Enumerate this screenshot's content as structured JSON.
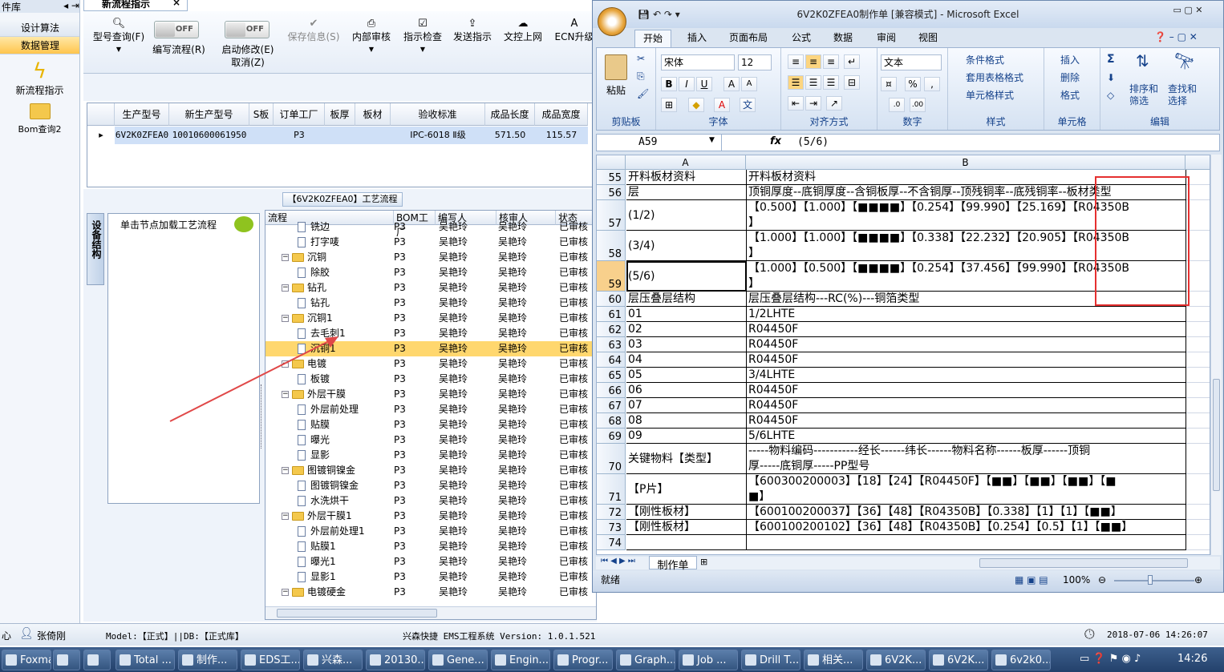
{
  "left_nav": {
    "header": "件库",
    "items": [
      {
        "label": "设计算法",
        "active": false
      },
      {
        "label": "数据管理",
        "active": true
      }
    ],
    "tools": [
      {
        "label": "新流程指示",
        "icon": "lightning-icon"
      },
      {
        "label": "Bom查询2",
        "icon": "folder-icon"
      }
    ]
  },
  "app": {
    "tab_title": "新流程指示",
    "toolbar": [
      {
        "label": "型号查询(F)",
        "icon": "search-icon"
      },
      {
        "label": "编写流程(R)",
        "toggle": "OFF"
      },
      {
        "label": "启动修改(E)",
        "sub": "取消(Z)",
        "toggle": "OFF"
      },
      {
        "label": "保存信息(S)",
        "icon": "check-icon"
      },
      {
        "label": "内部审核",
        "icon": "printer-icon"
      },
      {
        "label": "指示检查",
        "icon": "checkbox-icon"
      },
      {
        "label": "发送指示",
        "icon": "upload-icon"
      },
      {
        "label": "文控上网",
        "icon": "cloud-icon"
      },
      {
        "label": "ECN升级",
        "icon": "text-icon"
      }
    ],
    "grid": {
      "headers": [
        "生产型号",
        "新生产型号",
        "S板",
        "订单工厂",
        "板厚",
        "板材",
        "验收标准",
        "成品长度",
        "成品宽度"
      ],
      "row": [
        "6V2K0ZFEA0",
        "10010600061950",
        "",
        "P3",
        "",
        "",
        "IPC-6018 Ⅱ级",
        "571.50",
        "115.57"
      ]
    },
    "flow_title": "【6V2K0ZFEA0】工艺流程",
    "side_tab": "设备结构",
    "node_hint": "单击节点加载工艺流程",
    "tree_headers": [
      "流程",
      "BOM工厂",
      "编写人",
      "核审人",
      "状态"
    ],
    "tree_rows": [
      {
        "level": 2,
        "kind": "doc",
        "name": "铣边",
        "bom": "P3",
        "writer": "吴艳玲",
        "reviewer": "吴艳玲",
        "status": "已审核"
      },
      {
        "level": 2,
        "kind": "doc",
        "name": "打字唛",
        "bom": "P3",
        "writer": "吴艳玲",
        "reviewer": "吴艳玲",
        "status": "已审核"
      },
      {
        "level": 1,
        "kind": "folder",
        "name": "沉铜",
        "bom": "P3",
        "writer": "吴艳玲",
        "reviewer": "吴艳玲",
        "status": "已审核"
      },
      {
        "level": 2,
        "kind": "doc",
        "name": "除胶",
        "bom": "P3",
        "writer": "吴艳玲",
        "reviewer": "吴艳玲",
        "status": "已审核"
      },
      {
        "level": 1,
        "kind": "folder",
        "name": "钻孔",
        "bom": "P3",
        "writer": "吴艳玲",
        "reviewer": "吴艳玲",
        "status": "已审核"
      },
      {
        "level": 2,
        "kind": "doc",
        "name": "钻孔",
        "bom": "P3",
        "writer": "吴艳玲",
        "reviewer": "吴艳玲",
        "status": "已审核"
      },
      {
        "level": 1,
        "kind": "folder",
        "name": "沉铜1",
        "bom": "P3",
        "writer": "吴艳玲",
        "reviewer": "吴艳玲",
        "status": "已审核"
      },
      {
        "level": 2,
        "kind": "doc",
        "name": "去毛刺1",
        "bom": "P3",
        "writer": "吴艳玲",
        "reviewer": "吴艳玲",
        "status": "已审核"
      },
      {
        "level": 2,
        "kind": "doc",
        "name": "沉铜1",
        "bom": "P3",
        "writer": "吴艳玲",
        "reviewer": "吴艳玲",
        "status": "已审核",
        "selected": true
      },
      {
        "level": 1,
        "kind": "folder",
        "name": "电镀",
        "bom": "P3",
        "writer": "吴艳玲",
        "reviewer": "吴艳玲",
        "status": "已审核"
      },
      {
        "level": 2,
        "kind": "doc",
        "name": "板镀",
        "bom": "P3",
        "writer": "吴艳玲",
        "reviewer": "吴艳玲",
        "status": "已审核"
      },
      {
        "level": 1,
        "kind": "folder",
        "name": "外层干膜",
        "bom": "P3",
        "writer": "吴艳玲",
        "reviewer": "吴艳玲",
        "status": "已审核"
      },
      {
        "level": 2,
        "kind": "doc",
        "name": "外层前处理",
        "bom": "P3",
        "writer": "吴艳玲",
        "reviewer": "吴艳玲",
        "status": "已审核"
      },
      {
        "level": 2,
        "kind": "doc",
        "name": "贴膜",
        "bom": "P3",
        "writer": "吴艳玲",
        "reviewer": "吴艳玲",
        "status": "已审核"
      },
      {
        "level": 2,
        "kind": "doc",
        "name": "曝光",
        "bom": "P3",
        "writer": "吴艳玲",
        "reviewer": "吴艳玲",
        "status": "已审核"
      },
      {
        "level": 2,
        "kind": "doc",
        "name": "显影",
        "bom": "P3",
        "writer": "吴艳玲",
        "reviewer": "吴艳玲",
        "status": "已审核"
      },
      {
        "level": 1,
        "kind": "folder",
        "name": "图镀铜镍金",
        "bom": "P3",
        "writer": "吴艳玲",
        "reviewer": "吴艳玲",
        "status": "已审核"
      },
      {
        "level": 2,
        "kind": "doc",
        "name": "图镀铜镍金",
        "bom": "P3",
        "writer": "吴艳玲",
        "reviewer": "吴艳玲",
        "status": "已审核"
      },
      {
        "level": 2,
        "kind": "doc",
        "name": "水洗烘干",
        "bom": "P3",
        "writer": "吴艳玲",
        "reviewer": "吴艳玲",
        "status": "已审核"
      },
      {
        "level": 1,
        "kind": "folder",
        "name": "外层干膜1",
        "bom": "P3",
        "writer": "吴艳玲",
        "reviewer": "吴艳玲",
        "status": "已审核"
      },
      {
        "level": 2,
        "kind": "doc",
        "name": "外层前处理1",
        "bom": "P3",
        "writer": "吴艳玲",
        "reviewer": "吴艳玲",
        "status": "已审核"
      },
      {
        "level": 2,
        "kind": "doc",
        "name": "贴膜1",
        "bom": "P3",
        "writer": "吴艳玲",
        "reviewer": "吴艳玲",
        "status": "已审核"
      },
      {
        "level": 2,
        "kind": "doc",
        "name": "曝光1",
        "bom": "P3",
        "writer": "吴艳玲",
        "reviewer": "吴艳玲",
        "status": "已审核"
      },
      {
        "level": 2,
        "kind": "doc",
        "name": "显影1",
        "bom": "P3",
        "writer": "吴艳玲",
        "reviewer": "吴艳玲",
        "status": "已审核"
      },
      {
        "level": 1,
        "kind": "folder",
        "name": "电镀硬金",
        "bom": "P3",
        "writer": "吴艳玲",
        "reviewer": "吴艳玲",
        "status": "已审核"
      }
    ],
    "status_bar": {
      "prefix": "心",
      "user": "张倚刚",
      "model": "Model:【正式】||DB:【正式库】",
      "system": "兴森快捷 EMS工程系统 Version: 1.0.1.521",
      "datetime": "2018-07-06 14:26:07"
    }
  },
  "excel": {
    "title": "6V2K0ZFEA0制作单  [兼容模式] - Microsoft Excel",
    "tabs": [
      "开始",
      "插入",
      "页面布局",
      "公式",
      "数据",
      "审阅",
      "视图"
    ],
    "active_tab": "开始",
    "font_name": "宋体",
    "font_size": "12",
    "number_format": "文本",
    "groups": [
      "剪贴板",
      "字体",
      "对齐方式",
      "数字",
      "样式",
      "单元格",
      "编辑"
    ],
    "ribbon_labels": {
      "paste": "粘贴",
      "cond_format": "条件格式",
      "table_format": "套用表格格式",
      "cell_style": "单元格样式",
      "insert": "插入",
      "delete": "删除",
      "format": "格式",
      "sort": "排序和\n筛选",
      "find": "查找和\n选择"
    },
    "name_box": "A59",
    "formula": "(5/6)",
    "columns": [
      "A",
      "B"
    ],
    "rows": [
      {
        "n": "55",
        "a": "开料板材资料",
        "b": "开料板材资料",
        "h": 19
      },
      {
        "n": "56",
        "a": "层",
        "b": "顶铜厚度--底铜厚度--含铜板厚--不含铜厚--顶残铜率--底残铜率--板材类型",
        "h": 19
      },
      {
        "n": "57",
        "a": "(1/2)",
        "b": "【0.500】【1.000】【■■■■】【0.254】【99.990】【25.169】【R04350B",
        "b2": "】",
        "h": 38
      },
      {
        "n": "58",
        "a": "(3/4)",
        "b": "【1.000】【1.000】【■■■■】【0.338】【22.232】【20.905】【R04350B",
        "b2": "】",
        "h": 38
      },
      {
        "n": "59",
        "a": "(5/6)",
        "b": "【1.000】【0.500】【■■■■】【0.254】【37.456】【99.990】【R04350B",
        "b2": "】",
        "h": 38,
        "selected": true
      },
      {
        "n": "60",
        "a": "层压叠层结构",
        "b": "层压叠层结构---RC(%)---铜箔类型",
        "h": 19
      },
      {
        "n": "61",
        "a": "01",
        "b": "1/2LHTE",
        "h": 19
      },
      {
        "n": "62",
        "a": "02",
        "b": "R04450F",
        "h": 19
      },
      {
        "n": "63",
        "a": "03",
        "b": "R04450F",
        "h": 19
      },
      {
        "n": "64",
        "a": "04",
        "b": "R04450F",
        "h": 19
      },
      {
        "n": "65",
        "a": "05",
        "b": "3/4LHTE",
        "h": 19
      },
      {
        "n": "66",
        "a": "06",
        "b": "R04450F",
        "h": 19
      },
      {
        "n": "67",
        "a": "07",
        "b": "R04450F",
        "h": 19
      },
      {
        "n": "68",
        "a": "08",
        "b": "R04450F",
        "h": 19
      },
      {
        "n": "69",
        "a": "09",
        "b": "5/6LHTE",
        "h": 19
      },
      {
        "n": "70",
        "a": "关键物料【类型】",
        "b": "-----物料编码-----------经长------纬长------物料名称------板厚------顶铜",
        "b2": "厚-----底铜厚-----PP型号",
        "h": 38
      },
      {
        "n": "71",
        "a": "【P片】",
        "b": "【600300200003】【18】【24】【R04450F】【■■】【■■】【■■】【■",
        "b2": "■】",
        "h": 38
      },
      {
        "n": "72",
        "a": "【刚性板材】",
        "b": "【600100200037】【36】【48】【R04350B】【0.338】【1】【1】【■■】",
        "h": 19
      },
      {
        "n": "73",
        "a": "【刚性板材】",
        "b": "【600100200102】【36】【48】【R04350B】【0.254】【0.5】【1】【■■】",
        "h": 19
      },
      {
        "n": "74",
        "a": "",
        "b": "",
        "h": 19
      }
    ],
    "sheet_tab": "制作单",
    "status": "就绪",
    "zoom": "100%"
  },
  "taskbar": {
    "items": [
      "Foxmail",
      "",
      "",
      "Total ...",
      "制作...",
      "EDS工...",
      "兴森...",
      "20130...",
      "Gene...",
      "Engin...",
      "Progr...",
      "Graph...",
      "Job ...",
      "Drill T...",
      "相关...",
      "6V2K...",
      "6V2K...",
      "6v2k0..."
    ],
    "clock": "14:26"
  }
}
